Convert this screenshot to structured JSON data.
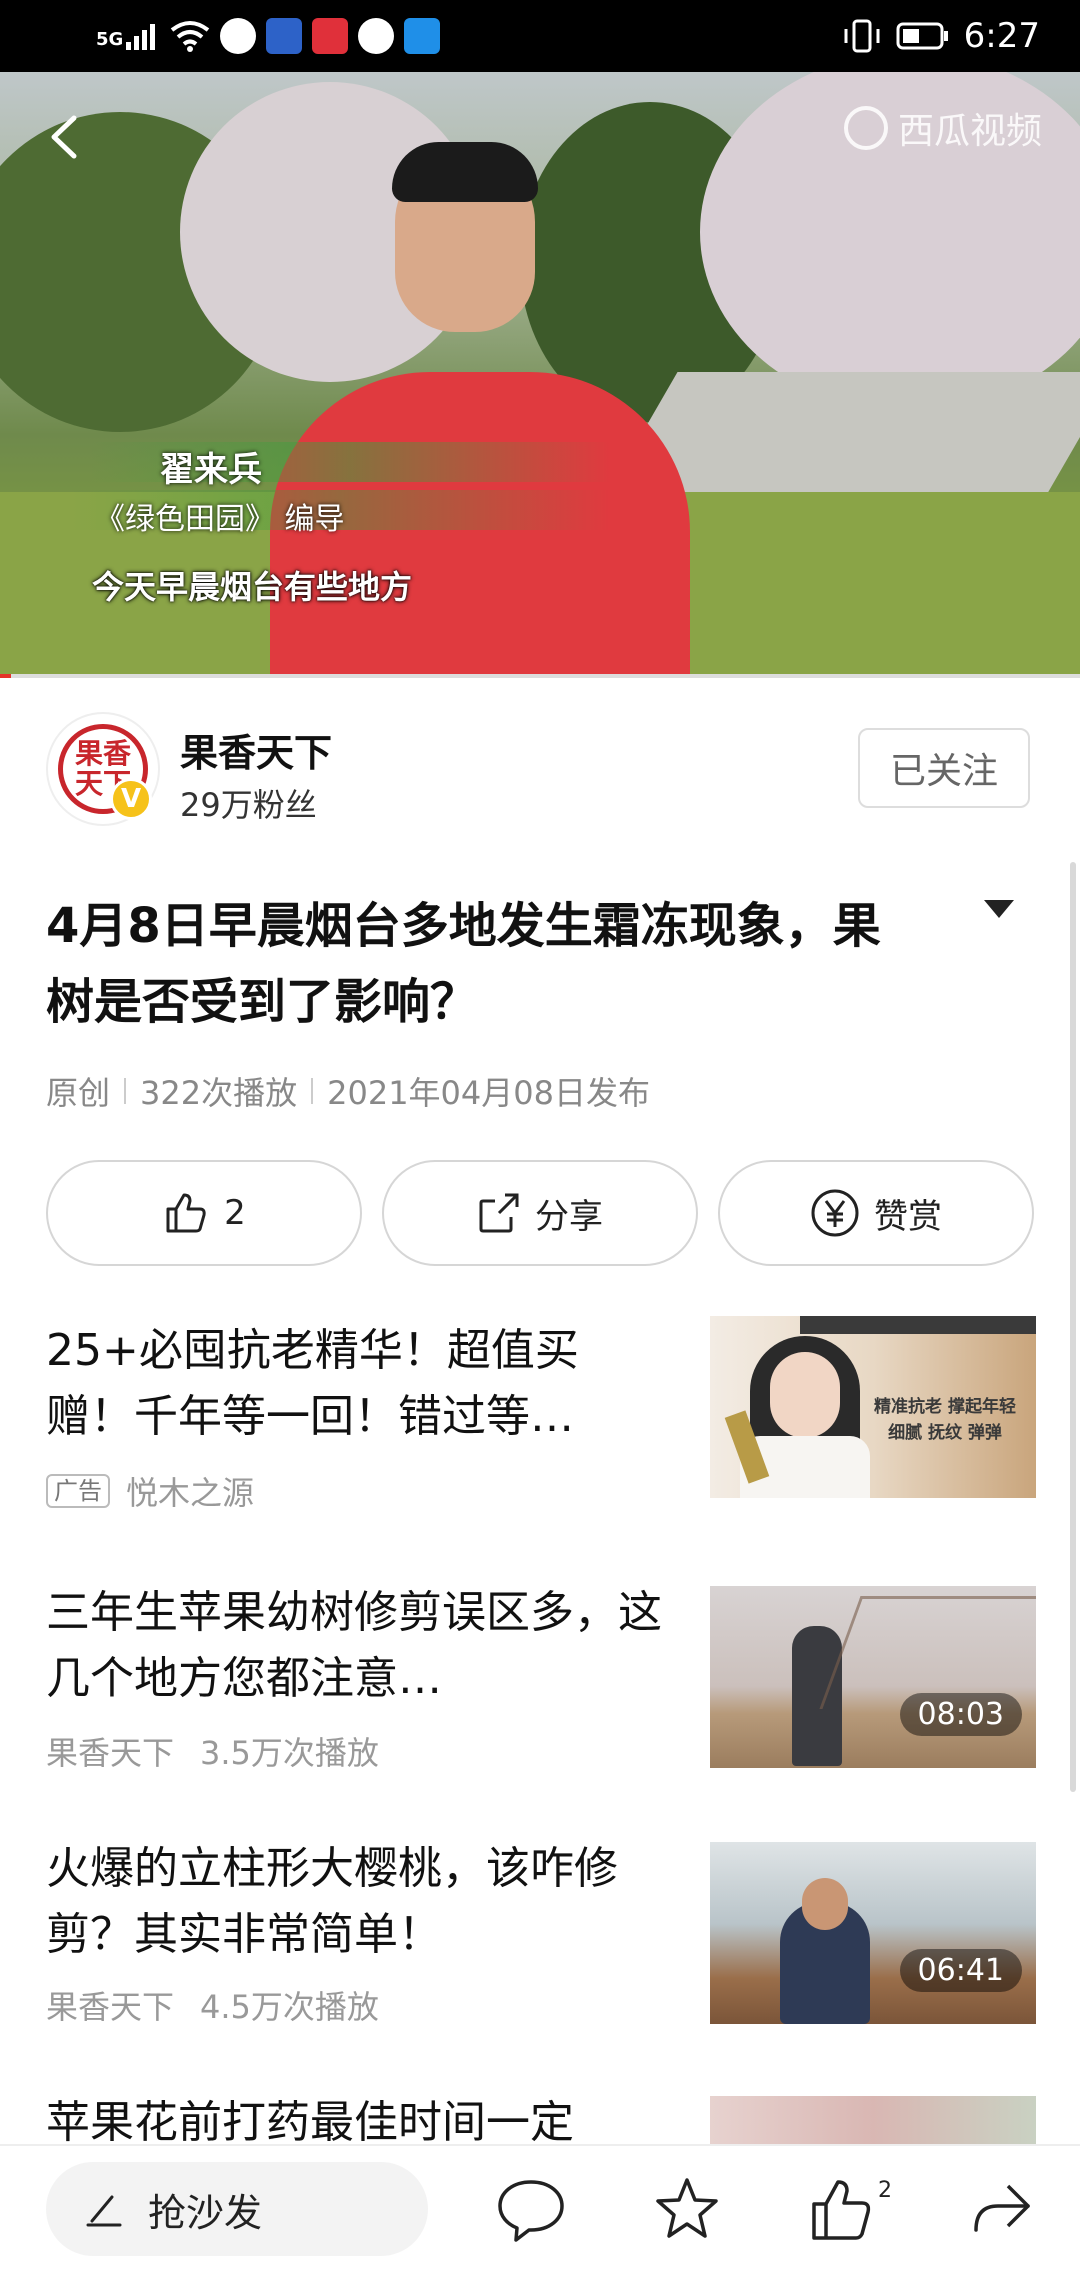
{
  "status_bar": {
    "network": "5G",
    "time": "6:27"
  },
  "video": {
    "watermark": "西瓜视频",
    "person_name": "翟来兵",
    "person_role": "《绿色田园》 编导",
    "subtitle": "今天早晨烟台有些地方",
    "progress": 0.01
  },
  "channel": {
    "name": "果香天下",
    "fans": "29万粉丝",
    "avatar_text": "果香天下",
    "follow_label": "已关注"
  },
  "article": {
    "title": "4月8日早晨烟台多地发生霜冻现象，果树是否受到了影响？",
    "meta": [
      "原创",
      "322次播放",
      "2021年04月08日发布"
    ]
  },
  "actions": {
    "like_count": "2",
    "share_label": "分享",
    "reward_label": "赞赏"
  },
  "feed": [
    {
      "title": "25+必囤抗老精华！超值买赠！千年等一回！错过等…",
      "ad_label": "广告",
      "source": "悦木之源",
      "views": "",
      "duration": "",
      "ad_text": "精准抗老 撑起年轻\n细腻 抚纹 弹弹"
    },
    {
      "title": "三年生苹果幼树修剪误区多，这几个地方您都注意…",
      "source": "果香天下",
      "views": "3.5万次播放",
      "duration": "08:03"
    },
    {
      "title": "火爆的立柱形大樱桃，该咋修剪？其实非常简单！",
      "source": "果香天下",
      "views": "4.5万次播放",
      "duration": "06:41"
    },
    {
      "title": "苹果花前打药最佳时间一定",
      "source": "",
      "views": "",
      "duration": ""
    }
  ],
  "bottom_bar": {
    "comment_placeholder": "抢沙发",
    "like_count": "2"
  },
  "colors": {
    "accent_red": "#e5332a",
    "verify_yellow": "#f6c21a",
    "seal_red": "#c8262c"
  }
}
